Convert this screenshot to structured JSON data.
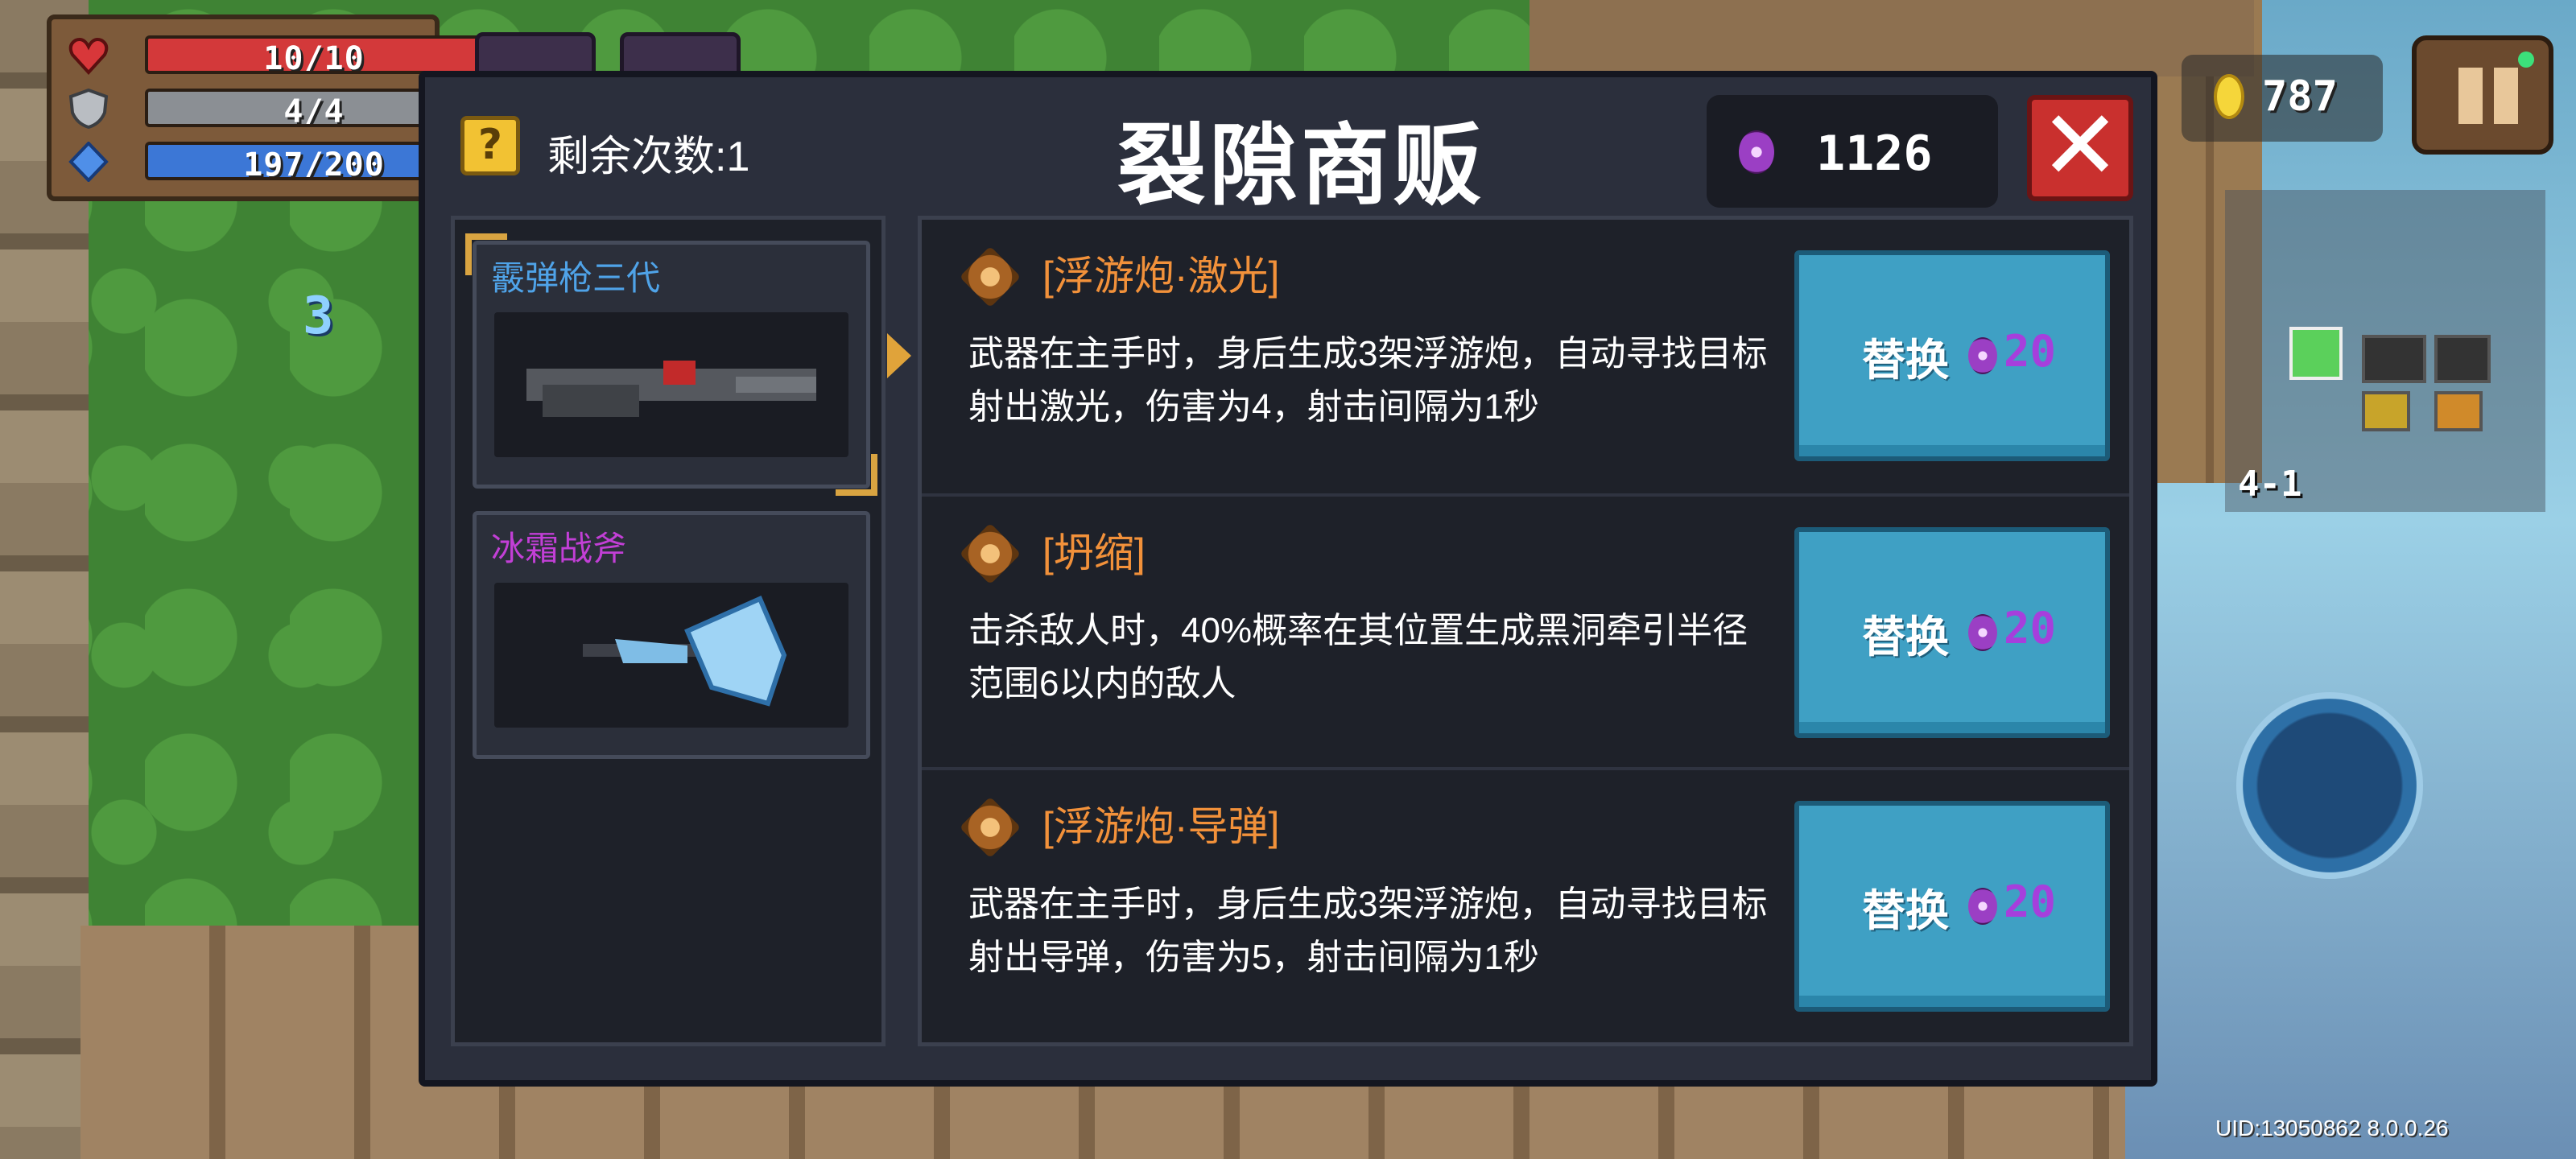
{
  "hud": {
    "hp": {
      "text": "10/10",
      "fraction": 1.0,
      "color": "#d3393a"
    },
    "armor": {
      "text": "4/4",
      "fraction": 1.0,
      "color": "#8b8f94"
    },
    "energy": {
      "text": "197/200",
      "fraction": 0.985,
      "color": "#3c77d6"
    },
    "coins": "787",
    "combo": "3",
    "level": "4-1",
    "uid": "UID:13050862 8.0.0.26"
  },
  "dialog": {
    "title": "裂隙商贩",
    "remaining": "剩余次数:1",
    "question_mark": "?",
    "gems": "1126",
    "close_label": "✕",
    "weapons": [
      {
        "name": "霰弹枪三代",
        "name_color": "#4fa3e8",
        "selected": true
      },
      {
        "name": "冰霜战斧",
        "name_color": "#c23fd6",
        "selected": false
      }
    ],
    "options": [
      {
        "name": "[浮游炮·激光]",
        "desc": "武器在主手时，身后生成3架浮游炮，自动寻找目标射出激光，伤害为4，射击间隔为1秒",
        "button": "替换",
        "cost": "20"
      },
      {
        "name": "[坍缩]",
        "desc": "击杀敌人时，40%概率在其位置生成黑洞牵引半径范围6以内的敌人",
        "button": "替换",
        "cost": "20"
      },
      {
        "name": "[浮游炮·导弹]",
        "desc": "武器在主手时，身后生成3架浮游炮，自动寻找目标射出导弹，伤害为5，射击间隔为1秒",
        "button": "替换",
        "cost": "20"
      }
    ]
  },
  "icons": {
    "hp": "heart-icon",
    "armor": "shield-icon",
    "energy": "diamond-icon",
    "coin": "coin-icon",
    "gem": "purple-gem-icon",
    "pause": "pause-icon",
    "option": "amber-crystal-icon"
  }
}
